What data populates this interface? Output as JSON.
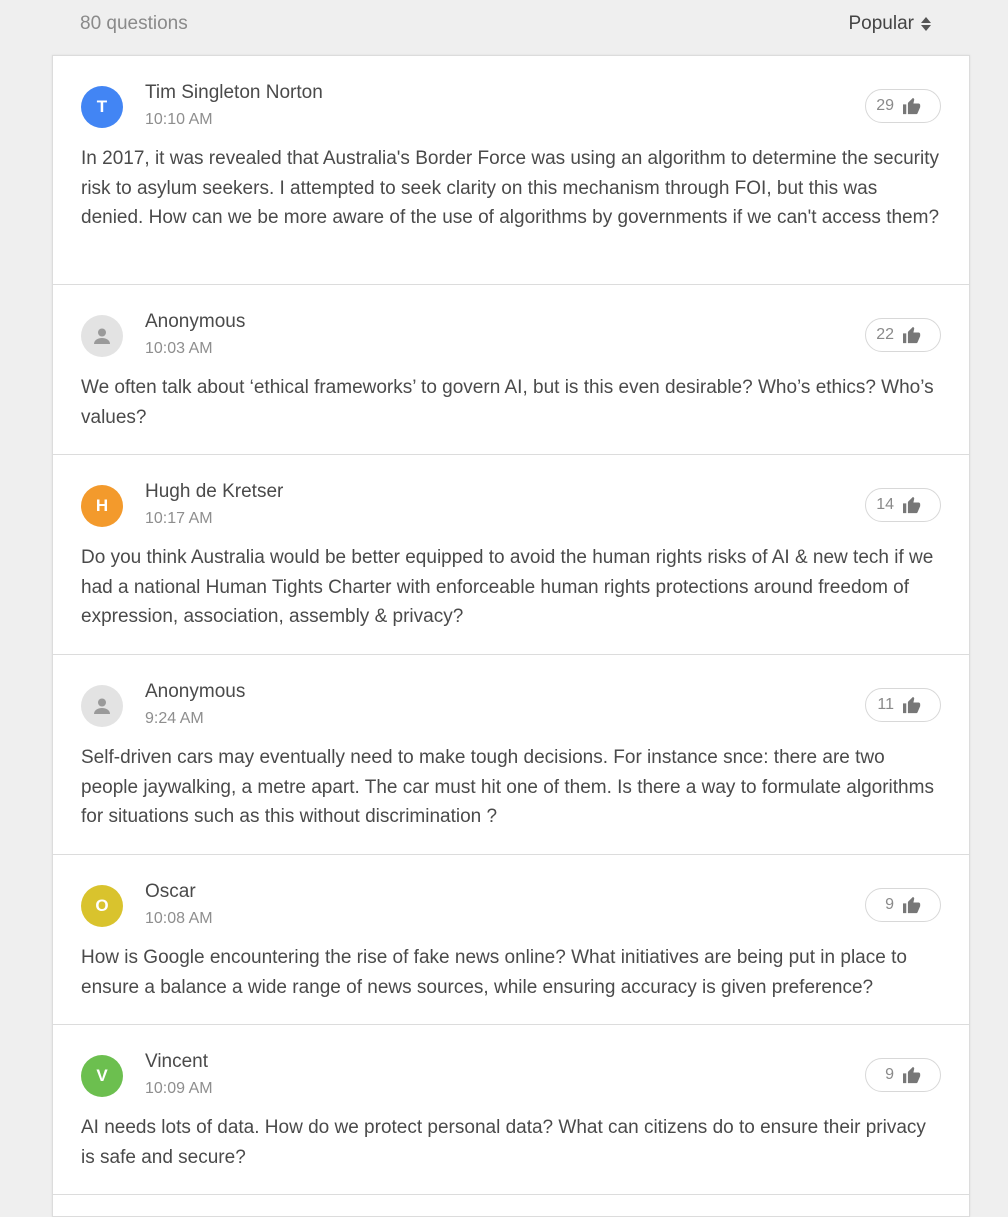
{
  "header": {
    "count_text": "80 questions",
    "sort_label": "Popular"
  },
  "colors": {
    "blue": "#4285f4",
    "orange": "#f39a2c",
    "yellow": "#d9c32d",
    "green": "#6cbf4f",
    "anon_bg": "#e3e3e3"
  },
  "questions": [
    {
      "initial": "T",
      "avatar_color": "#4285f4",
      "anonymous": false,
      "author": "Tim Singleton Norton",
      "time": "10:10 AM",
      "votes": "29",
      "text": "In 2017, it was revealed that Australia's Border Force was using an algorithm to determine the security risk to asylum seekers. I attempted to seek clarity on this mechanism through FOI, but this was denied. How can we be more aware of the use of algorithms by governments if we can't access them?"
    },
    {
      "initial": "",
      "avatar_color": "#e3e3e3",
      "anonymous": true,
      "author": "Anonymous",
      "time": "10:03 AM",
      "votes": "22",
      "text": "We often talk about ‘ethical frameworks’ to govern AI, but is this even desirable? Who’s ethics? Who’s values?"
    },
    {
      "initial": "H",
      "avatar_color": "#f39a2c",
      "anonymous": false,
      "author": "Hugh de Kretser",
      "time": "10:17 AM",
      "votes": "14",
      "text": "Do you think Australia would be better equipped to avoid the human rights risks of AI & new tech if we had a national Human Tights Charter with enforceable human rights protections around freedom of expression, association, assembly & privacy?"
    },
    {
      "initial": "",
      "avatar_color": "#e3e3e3",
      "anonymous": true,
      "author": "Anonymous",
      "time": "9:24 AM",
      "votes": "11",
      "text": "Self-driven cars may eventually need to make tough decisions. For instance snce: there are two people jaywalking, a metre apart. The car must hit one of them. Is there a way to formulate algorithms for situations such as this without discrimination ?"
    },
    {
      "initial": "O",
      "avatar_color": "#d9c32d",
      "anonymous": false,
      "author": "Oscar",
      "time": "10:08 AM",
      "votes": "9",
      "text": "How is Google encountering the rise of fake news online? What initiatives are being put in place to ensure a balance a wide range of news sources, while ensuring accuracy is given preference?"
    },
    {
      "initial": "V",
      "avatar_color": "#6cbf4f",
      "anonymous": false,
      "author": "Vincent",
      "time": "10:09 AM",
      "votes": "9",
      "text": "AI needs lots of data. How do we protect personal data? What can citizens do to ensure their privacy is safe and secure?"
    }
  ]
}
